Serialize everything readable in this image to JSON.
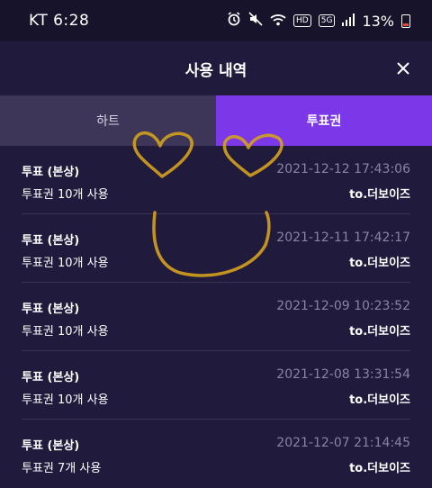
{
  "status_bar": {
    "carrier_time": "KT 6:28",
    "hd_label": "HD",
    "network_label": "5G",
    "battery": "13%"
  },
  "header": {
    "title": "사용 내역"
  },
  "tabs": [
    {
      "label": "하트",
      "active": false
    },
    {
      "label": "투표권",
      "active": true
    }
  ],
  "entries": [
    {
      "title": "투표 (본상)",
      "date": "2021-12-12 17:43:06",
      "desc": "투표권 10개 사용",
      "to": "to.더보이즈"
    },
    {
      "title": "투표 (본상)",
      "date": "2021-12-11 17:42:17",
      "desc": "투표권 10개 사용",
      "to": "to.더보이즈"
    },
    {
      "title": "투표 (본상)",
      "date": "2021-12-09 10:23:52",
      "desc": "투표권 10개 사용",
      "to": "to.더보이즈"
    },
    {
      "title": "투표 (본상)",
      "date": "2021-12-08 13:31:54",
      "desc": "투표권 10개 사용",
      "to": "to.더보이즈"
    },
    {
      "title": "투표 (본상)",
      "date": "2021-12-07 21:14:45",
      "desc": "투표권 7개 사용",
      "to": "to.더보이즈"
    }
  ],
  "colors": {
    "background": "#201a3c",
    "active_tab": "#7b37e8",
    "inactive_tab": "#3e3658",
    "doodle": "#d4a21c"
  },
  "icons": {
    "alarm": "alarm-icon",
    "mute": "mute-icon",
    "wifi": "wifi-icon",
    "signal": "signal-icon",
    "battery": "battery-icon",
    "close": "close-icon"
  }
}
